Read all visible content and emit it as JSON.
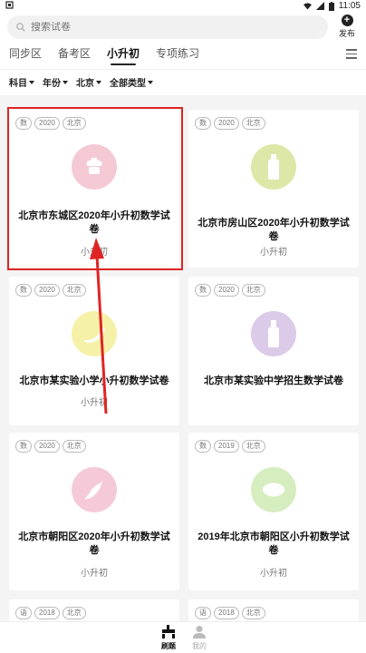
{
  "status": {
    "time": "11:05"
  },
  "search": {
    "placeholder": "搜索试卷"
  },
  "publish": {
    "label": "发布"
  },
  "tabs": [
    {
      "label": "同步区"
    },
    {
      "label": "备考区"
    },
    {
      "label": "小升初",
      "active": true
    },
    {
      "label": "专项练习"
    }
  ],
  "filters": [
    {
      "label": "科目"
    },
    {
      "label": "年份"
    },
    {
      "label": "北京"
    },
    {
      "label": "全部类型"
    }
  ],
  "cards": [
    {
      "tags": [
        "数",
        "2020",
        "北京"
      ],
      "icon": "cake-icon",
      "color": "#f5c9d4",
      "title": "北京市东城区2020年小升初数学试卷",
      "sub": "小升初"
    },
    {
      "tags": [
        "数",
        "2020",
        "北京"
      ],
      "icon": "bottle-icon",
      "color": "#dde8a8",
      "title": "北京市房山区2020年小升初数学试卷",
      "sub": "小升初"
    },
    {
      "tags": [
        "数",
        "2020",
        "北京"
      ],
      "icon": "banana-icon",
      "color": "#f6f1a8",
      "title": "北京市某实验小学小升初数学试卷",
      "sub": "小升初"
    },
    {
      "tags": [
        "数",
        "2020",
        "北京"
      ],
      "icon": "bottle-icon",
      "color": "#dccbe8",
      "title": "北京市某实验中学招生数学试卷",
      "sub": ""
    },
    {
      "tags": [
        "数",
        "2020",
        "北京"
      ],
      "icon": "pepper-icon",
      "color": "#f5c9d8",
      "title": "北京市朝阳区2020年小升初数学试卷",
      "sub": "小升初"
    },
    {
      "tags": [
        "数",
        "2019",
        "北京"
      ],
      "icon": "lemon-icon",
      "color": "#d6edc0",
      "title": "2019年北京市朝阳区小升初数学试卷",
      "sub": "小升初"
    },
    {
      "tags": [
        "语",
        "2018",
        "北京"
      ],
      "icon": "",
      "color": "",
      "title": "",
      "sub": ""
    },
    {
      "tags": [
        "语",
        "2018",
        "北京"
      ],
      "icon": "",
      "color": "",
      "title": "",
      "sub": ""
    }
  ],
  "nav": [
    {
      "label": "刷题",
      "active": true
    },
    {
      "label": "我的"
    }
  ]
}
